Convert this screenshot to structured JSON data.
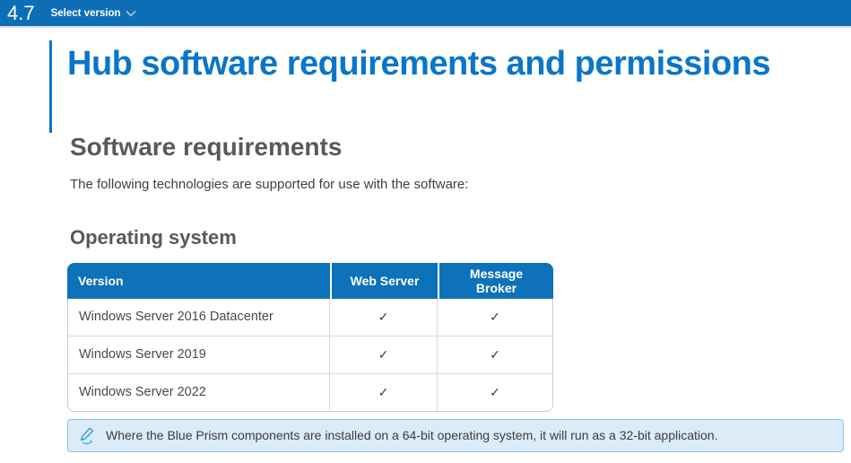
{
  "topbar": {
    "version": "4.7",
    "select_version_label": "Select version",
    "chevron_icon": "chevron-down-icon"
  },
  "page": {
    "title": "Hub software requirements and permissions",
    "section_heading": "Software requirements",
    "intro": "The following technologies are supported for use with the software:",
    "subsection_heading": "Operating system"
  },
  "table": {
    "columns": [
      "Version",
      "Web Server",
      "Message Broker"
    ],
    "rows": [
      {
        "version": "Windows Server 2016 Datacenter",
        "web_server": "✓",
        "message_broker": "✓"
      },
      {
        "version": "Windows Server 2019",
        "web_server": "✓",
        "message_broker": "✓"
      },
      {
        "version": "Windows Server 2022",
        "web_server": "✓",
        "message_broker": "✓"
      }
    ]
  },
  "note": {
    "icon": "pencil-icon",
    "text": "Where the Blue Prism components are installed on a 64-bit operating system, it will run as a 32-bit application."
  },
  "colors": {
    "topbar_blue": "#0d6eb5",
    "title_blue": "#0a76c8",
    "table_header_blue": "#0d72b9",
    "heading_gray": "#58595b",
    "note_background": "#dcebf8",
    "note_border": "#85c3e9"
  }
}
